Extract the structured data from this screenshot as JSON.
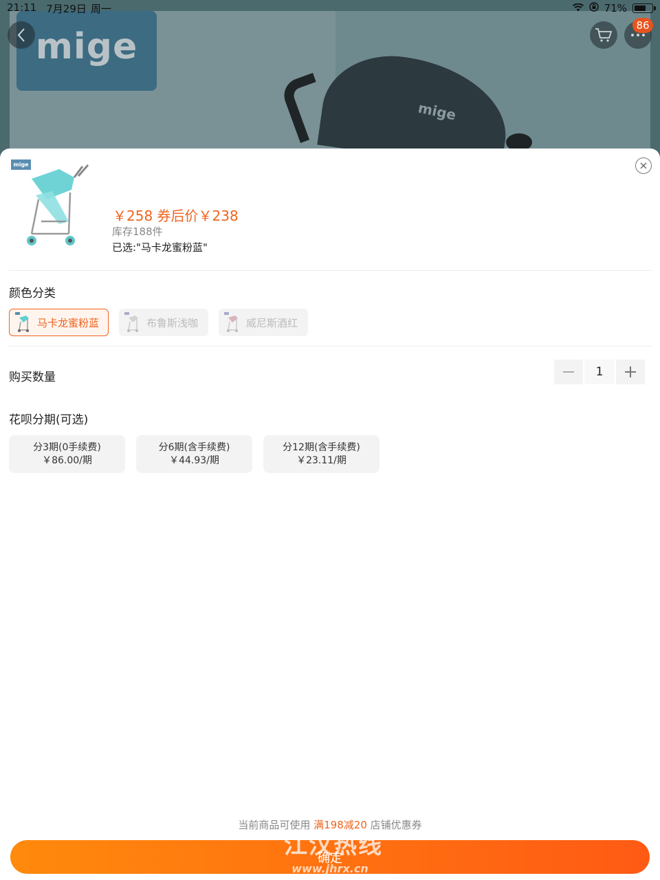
{
  "status_bar": {
    "time": "21:11",
    "date": "7月29日",
    "weekday": "周一",
    "battery_percent": "71%",
    "battery_level": 0.71
  },
  "background": {
    "brand": "mige",
    "canopy_logo": "mige"
  },
  "header": {
    "badge_count": "86"
  },
  "product": {
    "thumb_brand": "mige",
    "price_text": "￥258  券后价￥238",
    "stock_text": "库存188件",
    "selected_text": "已选:\"马卡龙蜜粉蓝\""
  },
  "color_section": {
    "title": "颜色分类",
    "options": [
      {
        "label": "马卡龙蜜粉蓝",
        "state": "selected",
        "swatch": "#5fd0d2"
      },
      {
        "label": "布鲁斯浅咖",
        "state": "disabled",
        "swatch": "#c9c9c9"
      },
      {
        "label": "威尼斯酒红",
        "state": "disabled",
        "swatch": "#c9a3ad"
      }
    ]
  },
  "quantity_section": {
    "title": "购买数量",
    "value": "1"
  },
  "installment_section": {
    "title": "花呗分期(可选)",
    "options": [
      {
        "line1": "分3期(0手续费)",
        "line2": "￥86.00/期"
      },
      {
        "line1": "分6期(含手续费)",
        "line2": "￥44.93/期"
      },
      {
        "line1": "分12期(含手续费)",
        "line2": "￥23.11/期"
      }
    ]
  },
  "footer": {
    "coupon_prefix": "当前商品可使用 ",
    "coupon_highlight": "满198减20",
    "coupon_suffix": " 店铺优惠券",
    "confirm_label": "确定",
    "watermark": "江汉热线",
    "watermark_url": "www.jhrx.cn"
  },
  "colors": {
    "accent": "#f0641e",
    "button_gradient_start": "#ff8a0c",
    "button_gradient_end": "#ff5a14"
  }
}
